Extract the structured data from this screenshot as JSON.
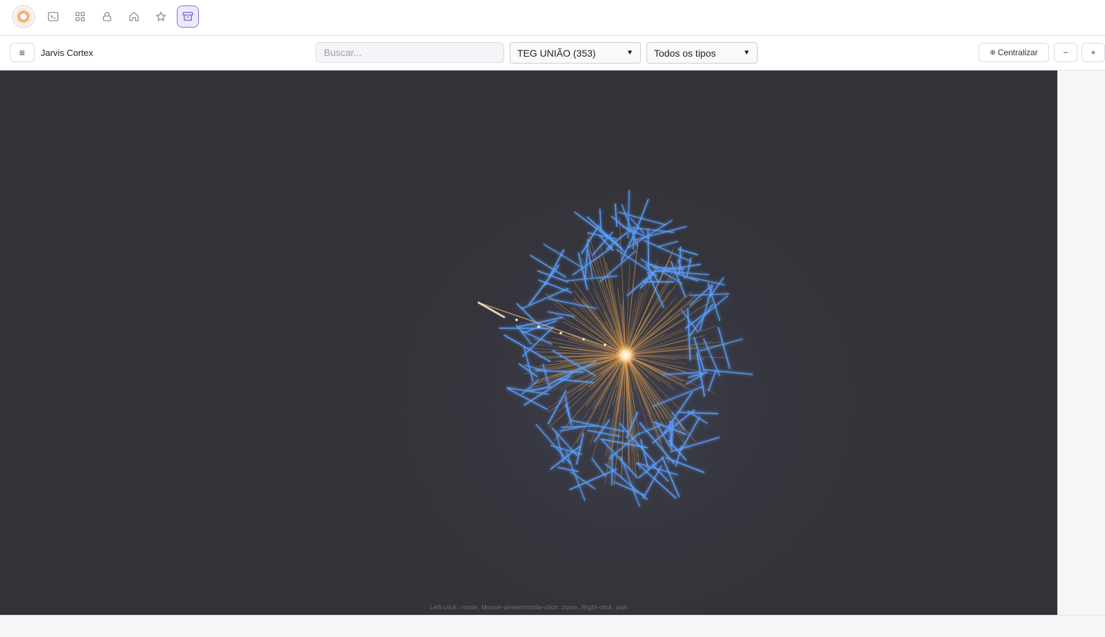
{
  "nav": {
    "icons": [
      "terminal-icon",
      "grid-icon",
      "lock-icon",
      "home-icon",
      "star-icon",
      "archive-icon"
    ],
    "active": "archive-icon",
    "accent": "#7c75d6"
  },
  "toolbar": {
    "menu_icon": "≡",
    "title": "Jarvis Cortex",
    "search_placeholder": "Buscar...",
    "group_select": "TEG UNIÃO (353)",
    "type_select": "Todos os tipos",
    "center_icon": "⊕",
    "center_label": "Centralizar",
    "zoom_out_label": "−",
    "zoom_in_label": "+"
  },
  "canvas": {
    "background": "#333338",
    "hint": "Left-click: rotate, Mouse-wheel/middle-click: zoom, Right-click: pan",
    "node_colors": {
      "blue": "#5aa0ff",
      "orange": "#e8a24c",
      "core": "#fff2d8"
    }
  }
}
